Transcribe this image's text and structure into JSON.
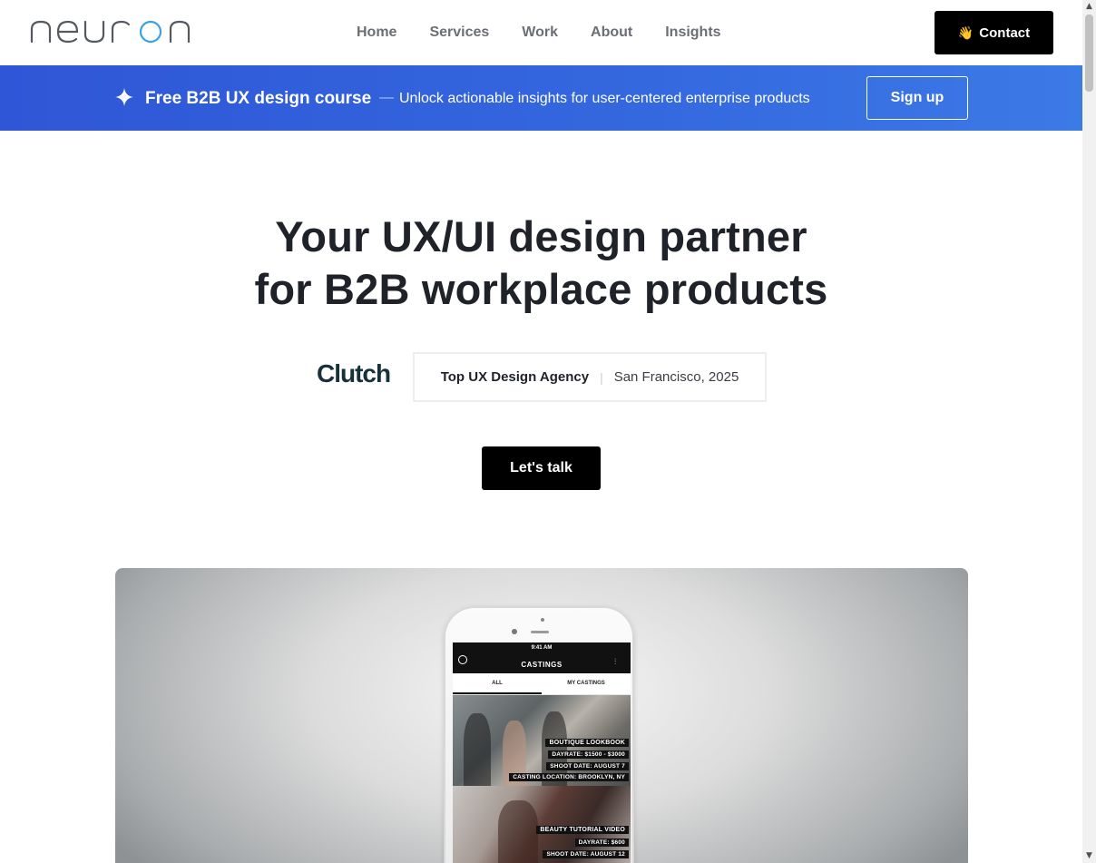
{
  "brand": {
    "name": "neuron"
  },
  "nav": {
    "items": [
      {
        "label": "Home"
      },
      {
        "label": "Services"
      },
      {
        "label": "Work"
      },
      {
        "label": "About"
      },
      {
        "label": "Insights"
      }
    ],
    "contact_label": "Contact",
    "contact_icon": "waving-hand-icon"
  },
  "banner": {
    "icon": "sparkle-icon",
    "title": "Free B2B UX design course",
    "dash": "—",
    "description": "Unlock actionable insights for user-centered enterprise products",
    "signup_label": "Sign up"
  },
  "hero": {
    "title_line1": "Your UX/UI design partner",
    "title_line2": "for B2B workplace products",
    "clutch_logo": "Clutch",
    "award": "Top UX Design Agency",
    "award_location": "San Francisco, 2025",
    "cta_label": "Let's talk"
  },
  "showcase": {
    "phone": {
      "time": "9:41 AM",
      "app_title": "CASTINGS",
      "tabs": [
        "ALL",
        "MY CASTINGS"
      ],
      "card1": {
        "title": "BOUTIQUE LOOKBOOK",
        "dayrate": "DAYRATE: $1500 - $3000",
        "shoot_date": "SHOOT DATE: AUGUST 7",
        "location": "CASTING LOCATION: BROOKLYN, NY"
      },
      "card2": {
        "title": "BEAUTY TUTORIAL VIDEO",
        "dayrate": "DAYRATE: $600",
        "shoot_date": "SHOOT DATE: AUGUST 12"
      }
    }
  },
  "colors": {
    "banner_start": "#2f56d6",
    "banner_end": "#3c7ae6",
    "logo_accent": "#3aa0e8",
    "cta_bg": "#000000",
    "clutch_dot": "#ef4335"
  }
}
